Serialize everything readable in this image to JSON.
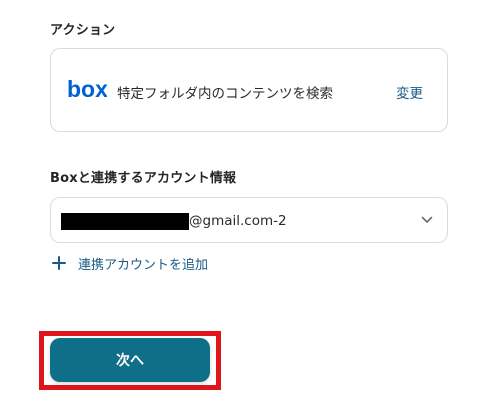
{
  "action_section": {
    "label": "アクション",
    "card": {
      "app_logo": "box",
      "app_icon": "box-logo-icon",
      "action_text": "特定フォルダ内のコンテンツを検索",
      "change_label": "変更"
    }
  },
  "account_section": {
    "label": "Boxと連携するアカウント情報",
    "selected_account_suffix": "@gmail.com-2",
    "dropdown_icon": "chevron-down-icon",
    "add_account_label": "連携アカウントを追加",
    "add_icon": "plus-icon"
  },
  "footer": {
    "next_button_label": "次へ"
  },
  "colors": {
    "accent": "#1b5a86",
    "primary_button": "#0f6e88",
    "box_brand": "#0061d5",
    "highlight": "#e0151b",
    "border": "#d9dbe0"
  }
}
